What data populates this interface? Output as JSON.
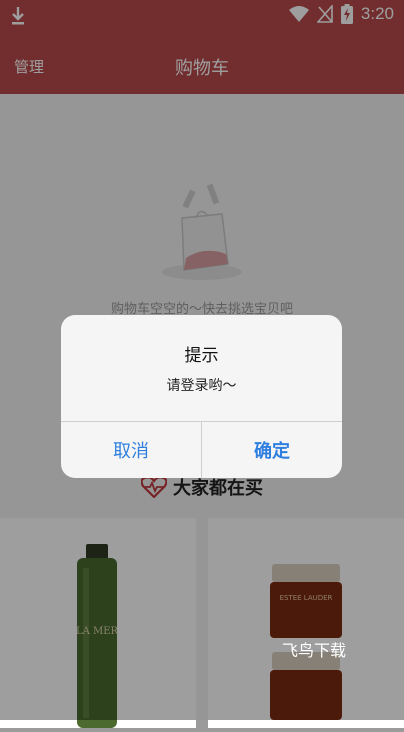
{
  "status_bar": {
    "time": "3:20"
  },
  "header": {
    "manage_label": "管理",
    "title": "购物车"
  },
  "cart": {
    "empty_text": "购物车空空的～快去挑选宝贝吧",
    "popular_label": "大家都在买"
  },
  "products": [
    {
      "brand": "LA MER"
    },
    {
      "brand": "ESTEE LAUDER"
    }
  ],
  "dialog": {
    "title": "提示",
    "message": "请登录哟～",
    "cancel_label": "取消",
    "confirm_label": "确定"
  },
  "watermark": "飞鸟下载",
  "colors": {
    "header_bg": "#b84a4c",
    "button_text": "#2f7fe0",
    "product_green": "#4a6a2e",
    "product_jar": "#7a2a12"
  }
}
